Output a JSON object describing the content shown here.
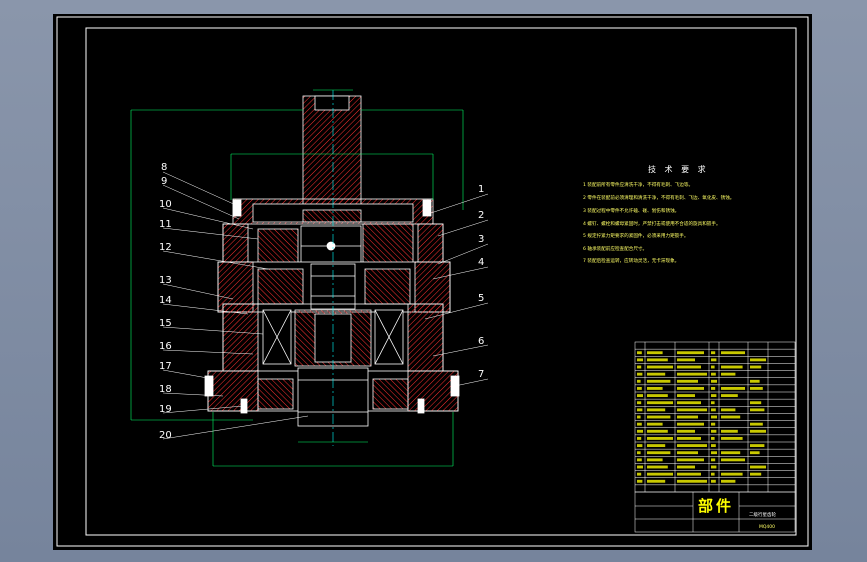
{
  "drawing": {
    "callouts_left": [
      "8",
      "9",
      "10",
      "11",
      "12",
      "13",
      "14",
      "15",
      "16",
      "17",
      "18",
      "19",
      "20"
    ],
    "callouts_right": [
      "1",
      "2",
      "3",
      "4",
      "5",
      "6",
      "7"
    ],
    "notes_title": "技 术 要 求",
    "notes": [
      "1 装配前所有零件应清洗干净，不得有毛刺、飞边等。",
      "2 零件在装配前必须清理和清洗干净，不得有毛刺、飞边、氧化皮、锈蚀。",
      "3 装配过程中零件不允许磕、碰、划伤和锈蚀。",
      "4 螺钉、螺栓和螺母紧固时，严禁打击或使用不合适的旋具和扳手。",
      "5 规定拧紧力矩要求的紧固件，必须采用力矩扳手。",
      "6 轴承装配前应检查配合尺寸。",
      "7 装配后检查运转，应转动灵活，无卡滞现象。"
    ],
    "title_block": {
      "part_word": "部件",
      "name": "二级行星齿轮",
      "drawing_no": "MQ400"
    }
  },
  "colors": {
    "background": "#7d8aa0",
    "sheet": "#000000",
    "frame": "#ffffff",
    "outline": "#ffffff",
    "hatch": "#ff3030",
    "dimension": "#00ff66",
    "centerline": "#00ffff",
    "text": "#ffff00"
  }
}
